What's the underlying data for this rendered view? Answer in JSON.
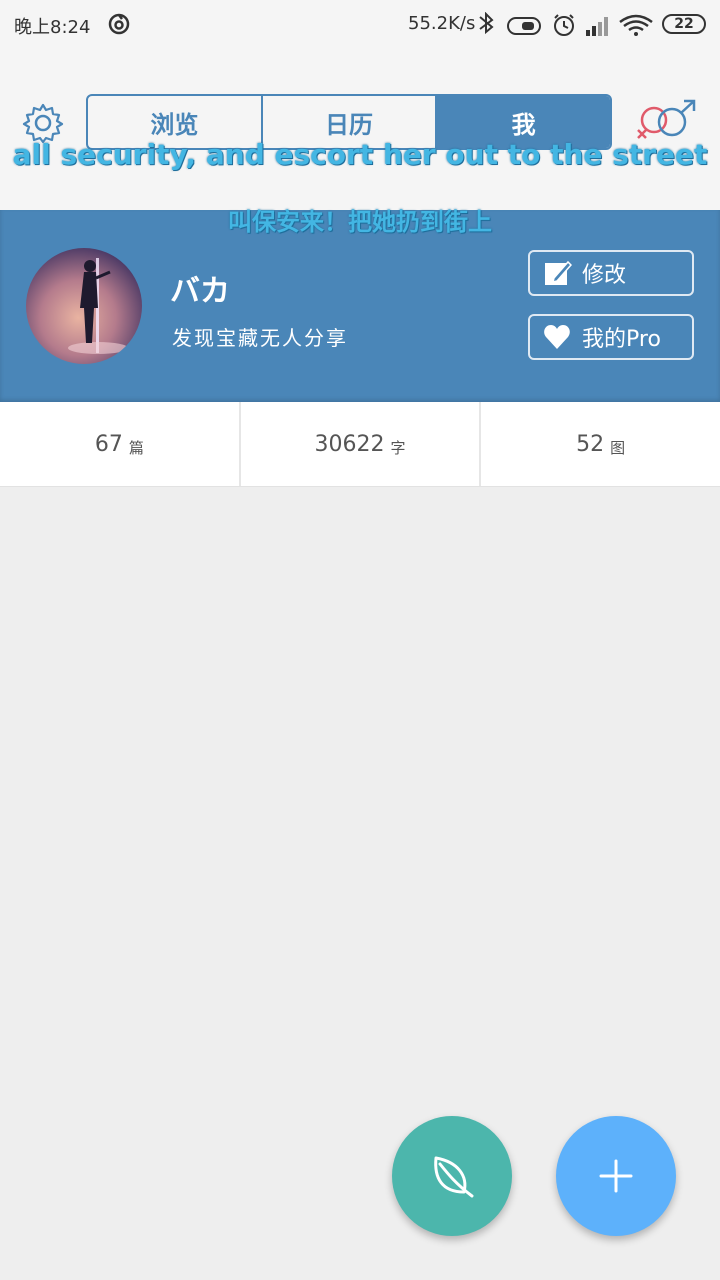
{
  "status_bar": {
    "time": "晚上8:24",
    "network_speed": "55.2K/s",
    "battery": "22",
    "icons": [
      "app-icon",
      "bluetooth-icon",
      "toggle-icon",
      "alarm-icon",
      "signal-icon",
      "wifi-icon",
      "battery-icon"
    ]
  },
  "header": {
    "tabs": [
      {
        "label": "浏览",
        "active": false
      },
      {
        "label": "日历",
        "active": false
      },
      {
        "label": "我",
        "active": true
      }
    ],
    "subtitle_en": "all security, and escort her out to the street",
    "subtitle_zh": "叫保安来！把她扔到街上",
    "icons": {
      "left": "gear-icon",
      "right": "gender-icon"
    }
  },
  "profile": {
    "name": "バカ",
    "bio": "发现宝藏无人分享",
    "edit_label": "修改",
    "pro_label": "我的Pro",
    "accent": "#4a86b8"
  },
  "stats": [
    {
      "num": "67",
      "unit": "篇"
    },
    {
      "num": "30622",
      "unit": "字"
    },
    {
      "num": "52",
      "unit": "图"
    }
  ],
  "fabs": {
    "leaf": {
      "icon": "leaf-icon",
      "color": "#4cb6ac"
    },
    "add": {
      "icon": "plus-icon",
      "color": "#5db1fb"
    }
  }
}
